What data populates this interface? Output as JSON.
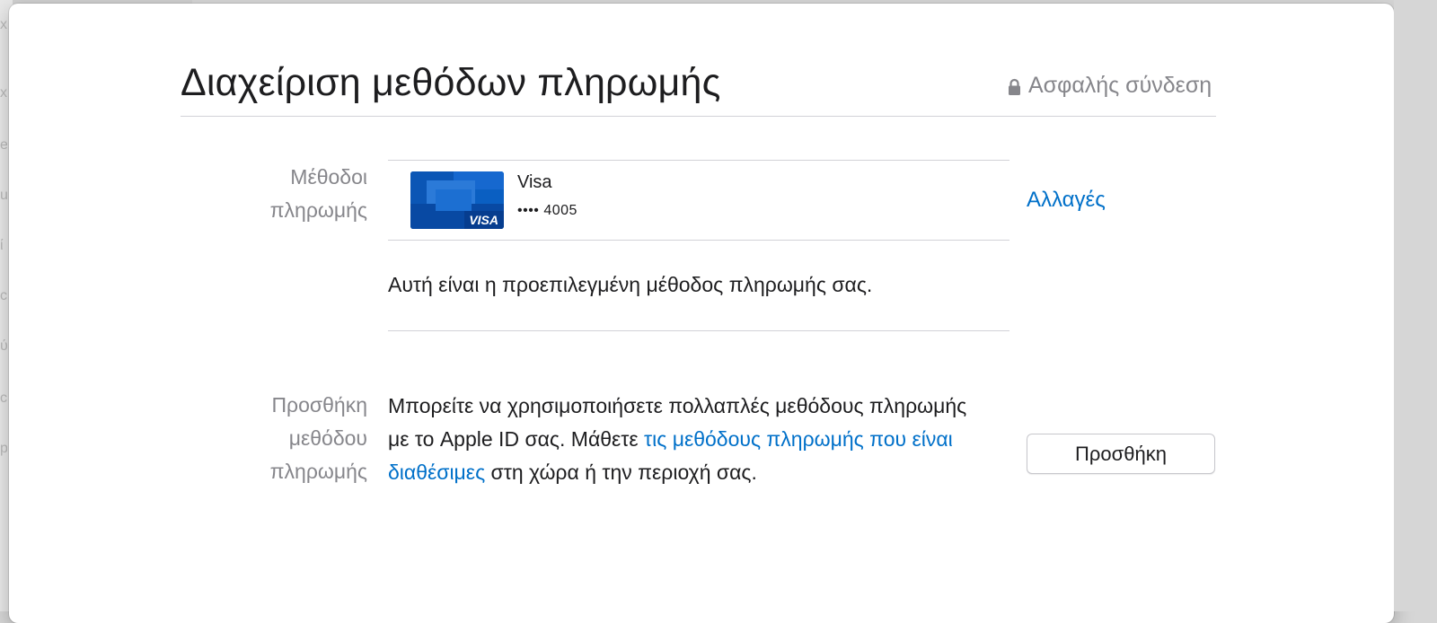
{
  "header": {
    "title": "Διαχείριση μεθόδων πληρωμής",
    "secure_label": "Ασφαλής σύνδεση"
  },
  "payment_methods": {
    "label_line1": "Μέθοδοι",
    "label_line2": "πληρωμής",
    "card": {
      "brand": "Visa",
      "masked_number": "•••• 4005",
      "logo_text": "VISA"
    },
    "change_link": "Αλλαγές",
    "default_note": "Αυτή είναι η προεπιλεγμένη μέθοδος πληρωμής σας."
  },
  "add_method": {
    "label_line1": "Προσθήκη",
    "label_line2": "μεθόδου",
    "label_line3": "πληρωμής",
    "desc_before": "Μπορείτε να χρησιμοποιήσετε πολλαπλές μεθόδους πληρωμής με το Apple ID σας. Μάθετε ",
    "desc_link": "τις μεθόδους πληρωμής που είναι διαθέσιμες",
    "desc_after": " στη χώρα ή την περιοχή σας.",
    "button_label": "Προσθήκη"
  },
  "colors": {
    "link": "#0070c9",
    "card_blue": "#0a5fc2"
  },
  "background_glyphs": [
    "x",
    "e",
    "u",
    "ί",
    "c",
    "ύ",
    "c",
    "p"
  ]
}
